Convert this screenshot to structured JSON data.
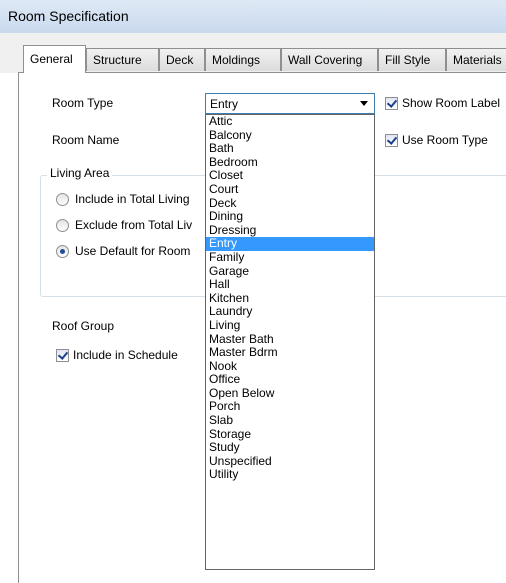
{
  "window": {
    "title": "Room Specification"
  },
  "tabs": [
    "General",
    "Structure",
    "Deck",
    "Moldings",
    "Wall Covering",
    "Fill Style",
    "Materials"
  ],
  "general": {
    "room_type_label": "Room Type",
    "room_type_value": "Entry",
    "room_name_label": "Room Name",
    "show_room_label": "Show Room Label",
    "use_room_type": "Use Room Type",
    "living_area": {
      "title": "Living Area",
      "opt_include": "Include in Total Living",
      "opt_exclude": "Exclude from Total Liv",
      "opt_default": "Use Default for Room"
    },
    "roof_group_label": "Roof Group",
    "include_in_schedule": "Include in Schedule"
  },
  "room_type_options": [
    "Attic",
    "Balcony",
    "Bath",
    "Bedroom",
    "Closet",
    "Court",
    "Deck",
    "Dining",
    "Dressing",
    "Entry",
    "Family",
    "Garage",
    "Hall",
    "Kitchen",
    "Laundry",
    "Living",
    "Master Bath",
    "Master Bdrm",
    "Nook",
    "Office",
    "Open Below",
    "Porch",
    "Slab",
    "Storage",
    "Study",
    "Unspecified",
    "Utility"
  ],
  "selected_option": "Entry"
}
